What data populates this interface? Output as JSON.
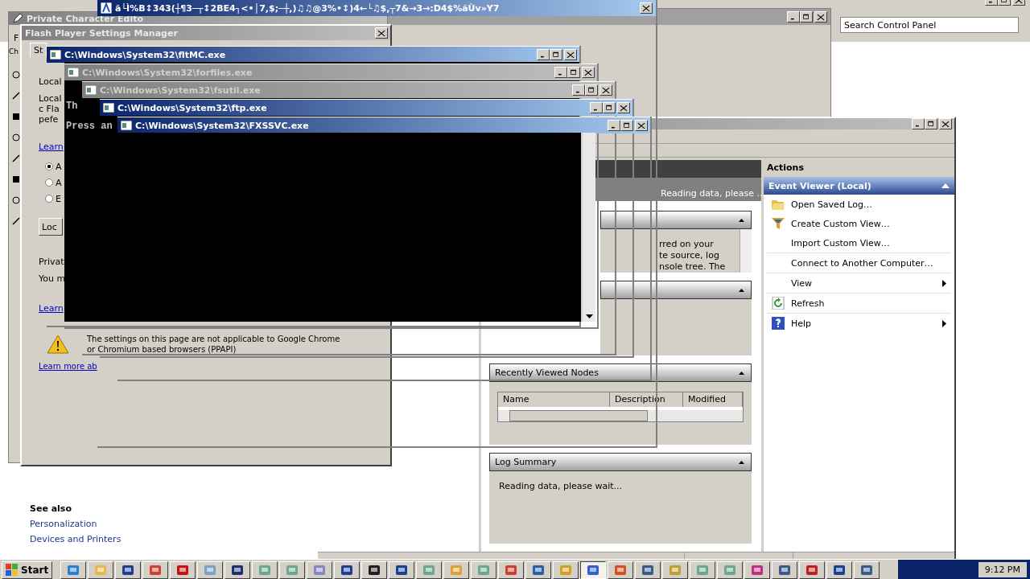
{
  "control_panel": {
    "search": {
      "placeholder": "Search Control Panel"
    },
    "see_also": {
      "title": "See also",
      "links": [
        "Personalization",
        "Devices and Printers"
      ]
    }
  },
  "event_viewer": {
    "status": "Reading data, please ...",
    "overview_lines": [
      "rred on your",
      "te source, log",
      "nsole tree. The"
    ],
    "recent_nodes": {
      "title": "Recently Viewed Nodes",
      "columns": [
        "Name",
        "Description",
        "Modified"
      ]
    },
    "log_summary": {
      "title": "Log Summary",
      "text": "Reading data, please wait..."
    },
    "actions": {
      "title": "Actions",
      "group": "Event Viewer (Local)",
      "items": [
        {
          "label": "Open Saved Log…",
          "kind": "folder",
          "submenu": false
        },
        {
          "label": "Create Custom View…",
          "kind": "filter",
          "submenu": false
        },
        {
          "label": "Import Custom View…",
          "kind": "plain",
          "submenu": false
        },
        {
          "label": "Connect to Another Computer…",
          "kind": "plain",
          "submenu": false
        },
        {
          "label": "View",
          "kind": "plain",
          "submenu": true
        },
        {
          "label": "Refresh",
          "kind": "refresh",
          "submenu": false
        },
        {
          "label": "Help",
          "kind": "help",
          "submenu": true
        }
      ]
    }
  },
  "private_character_editor": {
    "title": "Private Character Edito",
    "menu": "F",
    "label": "Ch"
  },
  "flash_settings": {
    "title": "Flash Player Settings Manager",
    "tab": "St",
    "lines": [
      "Local",
      "Local",
      "c Fla",
      "pefe"
    ],
    "link": "Learn",
    "radios": [
      {
        "label": "A",
        "selected": true
      },
      {
        "label": "A",
        "selected": false
      },
      {
        "label": "E",
        "selected": false
      }
    ],
    "button": "Loc",
    "lines2": [
      "Privat",
      "You m"
    ],
    "link2": "Learn",
    "warning": "The settings on this page are not applicable to Google Chrome or Chromium based browsers (PPAPI)",
    "more_link": "Learn more ab"
  },
  "garbled_window": {
    "title": "ā└Ì%B↕343(┼¶3─┬↕2BE4┐<•│7,$;─┼,)♫♫@3%•↕)4←└♫$,┬7&→3→:D4$%ãÙv»Y7"
  },
  "consoles": [
    {
      "title": "C:\\Windows\\System32\\fltMC.exe",
      "active": true,
      "kind": "black",
      "lines": [
        "Th",
        "Press an"
      ]
    },
    {
      "title": "C:\\Windows\\System32\\forfiles.exe",
      "active": false,
      "kind": "frame"
    },
    {
      "title": "C:\\Windows\\System32\\fsutil.exe",
      "active": false,
      "kind": "frame"
    },
    {
      "title": "C:\\Windows\\System32\\ftp.exe",
      "active": true,
      "kind": "frame"
    },
    {
      "title": "C:\\Windows\\System32\\FXSSVC.exe",
      "active": true,
      "kind": "black"
    }
  ],
  "taskbar": {
    "start": "Start",
    "buttons": [
      {
        "selected": false
      },
      {
        "selected": false
      },
      {
        "selected": false
      },
      {
        "selected": false
      },
      {
        "selected": false
      },
      {
        "selected": false
      },
      {
        "selected": false
      },
      {
        "selected": false
      },
      {
        "selected": false
      },
      {
        "selected": false
      },
      {
        "selected": false
      },
      {
        "selected": false
      },
      {
        "selected": false
      },
      {
        "selected": false
      },
      {
        "selected": false
      },
      {
        "selected": false
      },
      {
        "selected": false
      },
      {
        "selected": false
      },
      {
        "selected": false
      },
      {
        "selected": true
      },
      {
        "selected": false
      },
      {
        "selected": false
      },
      {
        "selected": false
      },
      {
        "selected": false
      },
      {
        "selected": false
      },
      {
        "selected": false
      },
      {
        "selected": false
      },
      {
        "selected": false
      },
      {
        "selected": false
      },
      {
        "selected": false
      }
    ],
    "clock": "9:12 PM"
  }
}
